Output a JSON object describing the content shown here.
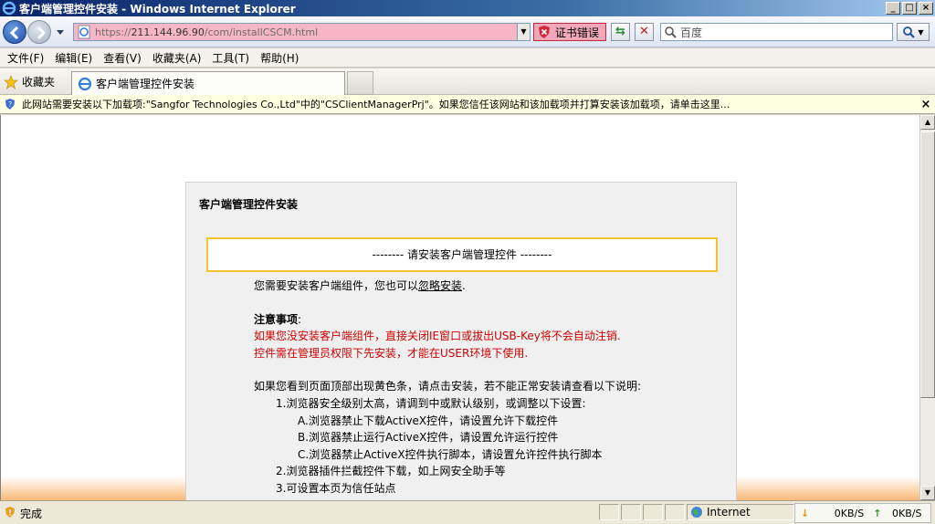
{
  "window": {
    "title": "客户端管理控件安装 - Windows Internet Explorer",
    "controls": [
      "_",
      "□",
      "×"
    ]
  },
  "address_bar": {
    "url_scheme": "https://",
    "url_host": "211.144.96.90",
    "url_path": "/com/installCSCM.html",
    "cert_error": "证书错误",
    "search_placeholder": "百度"
  },
  "menu": [
    "文件(F)",
    "编辑(E)",
    "查看(V)",
    "收藏夹(A)",
    "工具(T)",
    "帮助(H)"
  ],
  "favorites_label": "收藏夹",
  "tab": {
    "title": "客户端管理控件安装"
  },
  "info_bar": {
    "message": "此网站需要安装以下加载项:\"Sangfor Technologies Co.,Ltd\"中的\"CSClientManagerPrj\"。如果您信任该网站和该加载项并打算安装该加载项，请单击这里...",
    "close": "×"
  },
  "page": {
    "panel_title": "客户端管理控件安装",
    "notice": "-------- 请安装客户端管理控件 --------",
    "intro_prefix": "您需要安装客户端组件，您也可以",
    "intro_link": "忽略安装",
    "intro_suffix": ".",
    "notes_title": "注意事项",
    "notes_colon": ":",
    "warning_lines": [
      "如果您没安装客户端组件，直接关闭IE窗口或拔出USB-Key将不会自动注销.",
      "控件需在管理员权限下先安装，才能在USER环境下使用."
    ],
    "help_intro": "如果您看到页面顶部出现黄色条，请点击安装，若不能正常安装请查看以下说明:",
    "help_items": [
      {
        "text": "1.浏览器安全级别太高，请调到中或默认级别，或调整以下设置:",
        "level": 1
      },
      {
        "text": "A.浏览器禁止下载ActiveX控件，请设置允许下载控件",
        "level": 2
      },
      {
        "text": "B.浏览器禁止运行ActiveX控件，请设置允许运行控件",
        "level": 2
      },
      {
        "text": "C.浏览器禁止ActiveX控件执行脚本，请设置允许控件执行脚本",
        "level": 2
      },
      {
        "text": "2.浏览器插件拦截控件下载，如上网安全助手等",
        "level": 1
      },
      {
        "text": "3.可设置本页为信任站点",
        "level": 1
      }
    ]
  },
  "status_bar": {
    "status": "完成",
    "zone": "Internet",
    "download_speed": "0KB/S",
    "upload_speed": "0KB/S"
  },
  "colors": {
    "titlebar_start": "#0a246a",
    "address_error_bg": "#f7b6c6",
    "infobar_bg": "#ffffe1",
    "notice_border": "#f2c230",
    "warning_text": "#d00000"
  }
}
